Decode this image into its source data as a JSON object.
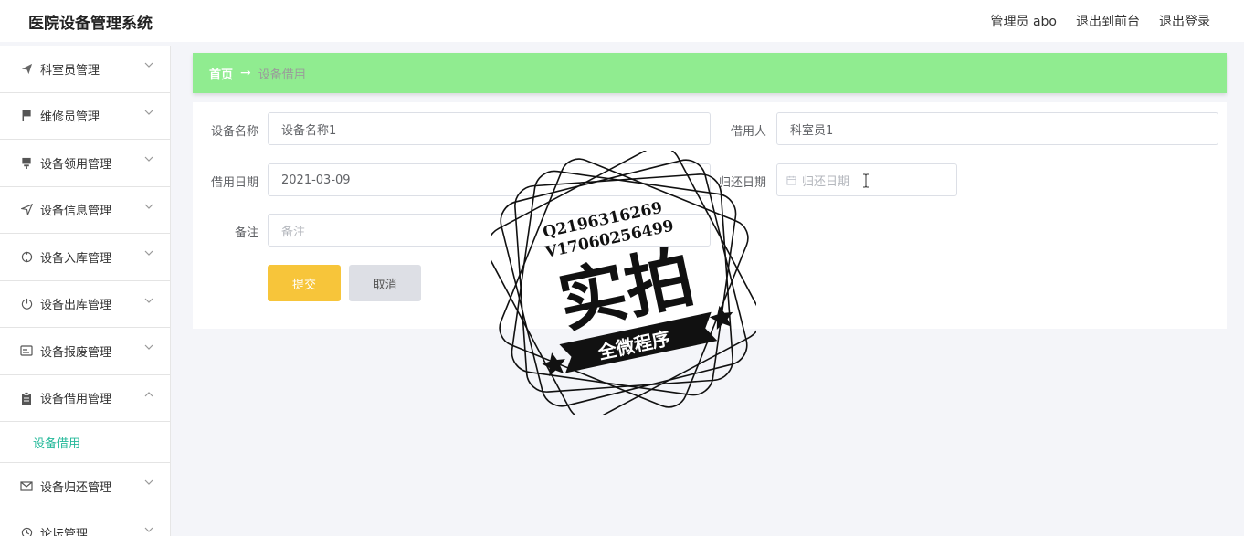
{
  "app": {
    "title": "医院设备管理系统"
  },
  "header": {
    "user_label": "管理员 abo",
    "front_link": "退出到前台",
    "logout_link": "退出登录"
  },
  "sidebar": {
    "items": [
      {
        "label": "科室员管理",
        "icon": "paper-plane-icon"
      },
      {
        "label": "维修员管理",
        "icon": "flag-icon"
      },
      {
        "label": "设备领用管理",
        "icon": "stamp-icon"
      },
      {
        "label": "设备信息管理",
        "icon": "send-icon"
      },
      {
        "label": "设备入库管理",
        "icon": "crosshair-icon"
      },
      {
        "label": "设备出库管理",
        "icon": "power-icon"
      },
      {
        "label": "设备报废管理",
        "icon": "id-card-icon"
      },
      {
        "label": "设备借用管理",
        "icon": "clipboard-icon"
      },
      {
        "label": "设备归还管理",
        "icon": "mail-icon"
      },
      {
        "label": "论坛管理",
        "icon": "clock-icon"
      }
    ],
    "sub_item": "设备借用"
  },
  "breadcrumb": {
    "home": "首页",
    "arrow": "→",
    "current": "设备借用"
  },
  "form": {
    "device_name_label": "设备名称",
    "device_name_value": "设备名称1",
    "borrower_label": "借用人",
    "borrower_value": "科室员1",
    "borrow_date_label": "借用日期",
    "borrow_date_value": "2021-03-09",
    "return_date_label": "归还日期",
    "return_date_placeholder": "归还日期",
    "remark_label": "备注",
    "remark_placeholder": "备注",
    "submit_label": "提交",
    "cancel_label": "取消"
  },
  "watermark": {
    "line1": "Q2196316269",
    "line2": "V17060256499",
    "big_text": "实拍",
    "banner_text": "全微程序"
  },
  "colors": {
    "breadcrumb_bg": "#90ec90",
    "accent": "#25b99a",
    "submit_bg": "#f7c53a",
    "cancel_bg": "#dddfe5"
  }
}
